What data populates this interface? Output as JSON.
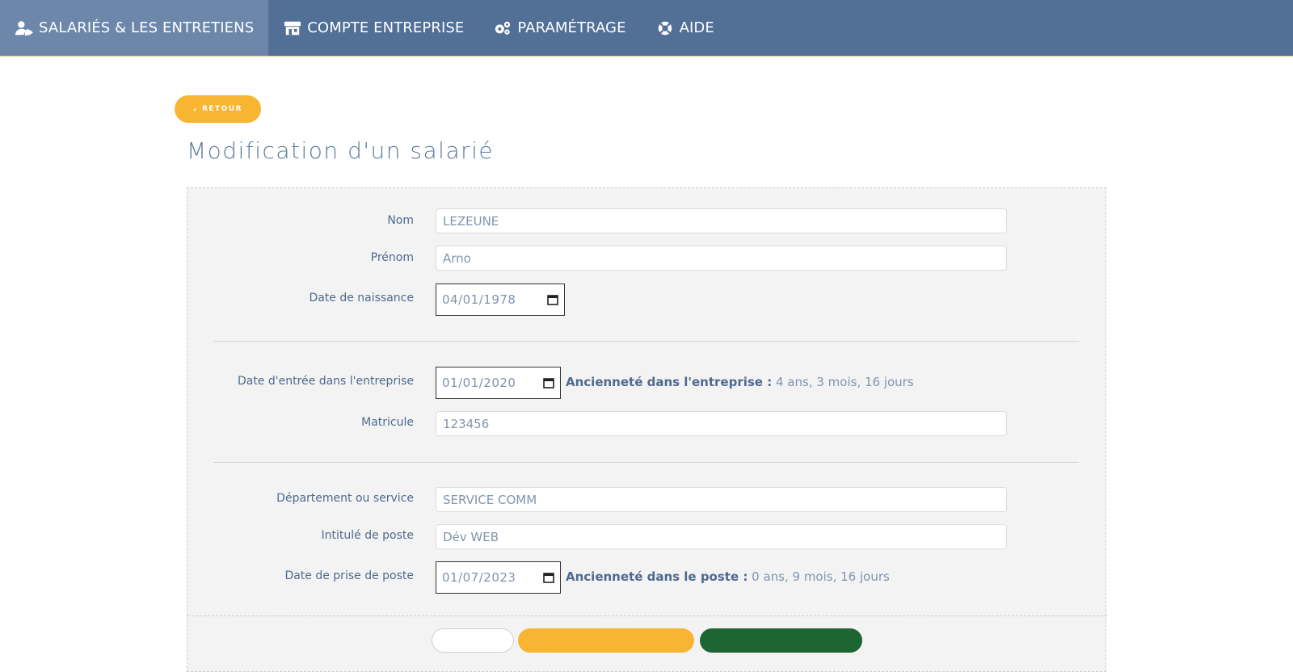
{
  "nav": {
    "items": [
      {
        "label": "SALARIÉS & LES ENTRETIENS",
        "icon": "users-icon",
        "active": true
      },
      {
        "label": "COMPTE ENTREPRISE",
        "icon": "store-icon",
        "active": false
      },
      {
        "label": "PARAMÉTRAGE",
        "icon": "cogs-icon",
        "active": false
      },
      {
        "label": "AIDE",
        "icon": "lifebuoy-icon",
        "active": false
      }
    ]
  },
  "back_label": "RETOUR",
  "page_title": "Modification d'un salarié",
  "form": {
    "nom": {
      "label": "Nom",
      "value": "LEZEUNE"
    },
    "prenom": {
      "label": "Prénom",
      "value": "Arno"
    },
    "naissance": {
      "label": "Date de naissance",
      "value": "04/01/1978"
    },
    "entree": {
      "label": "Date d'entrée dans l'entreprise",
      "value": "01/01/2020"
    },
    "anciennete_entreprise": {
      "label": "Ancienneté dans l'entreprise :",
      "value": "4 ans, 3 mois, 16 jours"
    },
    "matricule": {
      "label": "Matricule",
      "value": "123456"
    },
    "departement": {
      "label": "Département ou service",
      "value": "SERVICE COMM"
    },
    "poste": {
      "label": "Intitulé de poste",
      "value": "Dév WEB"
    },
    "prise_poste": {
      "label": "Date de prise de poste",
      "value": "01/07/2023"
    },
    "anciennete_poste": {
      "label": "Ancienneté dans le poste :",
      "value": "0 ans, 9 mois, 16 jours"
    }
  },
  "colors": {
    "nav_bg": "#526f96",
    "nav_active": "#6d87ab",
    "accent_orange": "#f8b531",
    "accent_green": "#1e6534",
    "text_blue": "#4f6a8f"
  }
}
